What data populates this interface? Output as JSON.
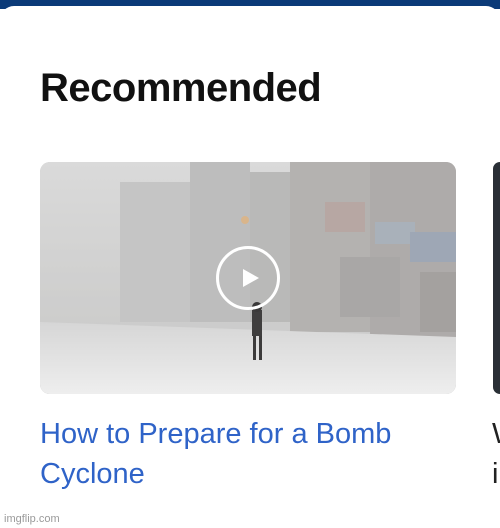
{
  "section": {
    "title": "Recommended"
  },
  "video": {
    "title": "How to Prepare for a Bomb Cyclone",
    "thumbnail_icon": "play-icon"
  },
  "next_card": {
    "title_line1": "W",
    "title_line2": "i"
  },
  "watermark": "imgflip.com",
  "colors": {
    "top_bar": "#0b3a78",
    "link": "#2f63c8",
    "title": "#111111"
  }
}
